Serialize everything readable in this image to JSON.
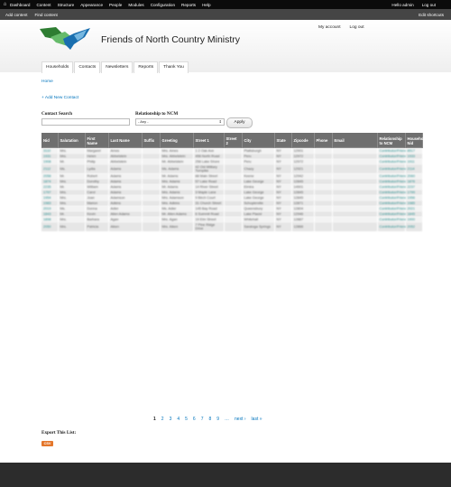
{
  "admin_menu": {
    "home_icon": "home-icon",
    "items": [
      "Dashboard",
      "Content",
      "Structure",
      "Appearance",
      "People",
      "Modules",
      "Configuration",
      "Reports",
      "Help"
    ],
    "hello": "Hello admin",
    "logout": "Log out"
  },
  "shortcuts": {
    "links": [
      "Add content",
      "Find content"
    ],
    "edit": "Edit shortcuts"
  },
  "header": {
    "site_name": "Friends of North Country Ministry",
    "my_account": "My account",
    "logout": "Log out",
    "logo_colors": [
      "#2e7d32",
      "#66bb6a",
      "#1a6faf",
      "#76b7e0"
    ]
  },
  "tabs": [
    "Households",
    "Contacts",
    "Newsletters",
    "Reports",
    "Thank You"
  ],
  "breadcrumb": "Home",
  "add_new": "+ Add New Contact",
  "filters": {
    "search_label": "Contact Search",
    "relationship_label": "Relationship to NCM",
    "relationship_value": "- Any -",
    "apply": "Apply"
  },
  "table": {
    "headers": [
      "Nid",
      "Salutation",
      "First Name",
      "Last Name",
      "Suffix",
      "Greeting",
      "Street 1",
      "Street 2",
      "City",
      "State",
      "Zipcode",
      "Phone",
      "Email",
      "Relationship to NCM",
      "Household Nid"
    ],
    "rows": [
      [
        "3110",
        "Mrs.",
        "Margaret",
        "Ames",
        "",
        "Mrs. Ames",
        "1 2 Oak Ave",
        "",
        "Plattsburgh",
        "NY",
        "12901",
        "",
        "",
        "Contributor/Friend",
        "8517"
      ],
      [
        "1931",
        "Mrs.",
        "Helen",
        "Abbelstein",
        "",
        "Mrs. Abbelstein",
        "456 North Road",
        "",
        "Peru",
        "NY",
        "12972",
        "",
        "",
        "Contributor/Friend",
        "1933"
      ],
      [
        "1908",
        "Mr.",
        "Philip",
        "Abbelstein",
        "",
        "Mr. Abbelstein",
        "256 Lake Shore",
        "",
        "Peru",
        "NY",
        "12972",
        "",
        "",
        "Contributor/Friend",
        "1911"
      ],
      [
        "2112",
        "Ms.",
        "Lydia",
        "Adams",
        "",
        "Ms. Adams",
        "42 Old Military Turnpike",
        "",
        "Chazy",
        "NY",
        "12921",
        "",
        "",
        "Contributor/Friend",
        "2114"
      ],
      [
        "2058",
        "Mr.",
        "Robert",
        "Adams",
        "",
        "Mr. Adams",
        "88 Main Street",
        "",
        "Keene",
        "NY",
        "12942",
        "",
        "",
        "Contributor/Friend",
        "2060"
      ],
      [
        "1874",
        "Mrs.",
        "Dorothy",
        "Adams",
        "",
        "Mrs. Adams",
        "57 Lake Road",
        "",
        "Lake George",
        "NY",
        "12845",
        "",
        "",
        "Contributor/Friend",
        "1876"
      ],
      [
        "2235",
        "Mr.",
        "William",
        "Adams",
        "",
        "Mr. Adams",
        "14 River Street",
        "",
        "Elmira",
        "NY",
        "14901",
        "",
        "",
        "Contributor/Friend",
        "2237"
      ],
      [
        "1797",
        "Mrs.",
        "Carol",
        "Adams",
        "",
        "Mrs. Adams",
        "3 Maple Lane",
        "",
        "Lake George",
        "NY",
        "12845",
        "",
        "",
        "Contributor/Friend",
        "1799"
      ],
      [
        "1954",
        "Mrs.",
        "Joan",
        "Adamson",
        "",
        "Mrs. Adamson",
        "9 Birch Court",
        "",
        "Lake George",
        "NY",
        "12845",
        "",
        "",
        "Contributor/Friend",
        "1956"
      ],
      [
        "1983",
        "Mrs.",
        "Marion",
        "Adkins",
        "",
        "Mrs. Adkins",
        "31 Church Street",
        "",
        "Schuylerville",
        "NY",
        "12871",
        "",
        "",
        "Contributor/Friend",
        "1985"
      ],
      [
        "2019",
        "Ms.",
        "Donna",
        "Adler",
        "",
        "Ms. Adler",
        "145 Bay Road",
        "",
        "Queensbury",
        "NY",
        "12804",
        "",
        "",
        "Contributor/Friend",
        "2021"
      ],
      [
        "1843",
        "Mr.",
        "Kevin",
        "Allen Adams",
        "",
        "Mr. Allen Adams",
        "6 Summit Road",
        "",
        "Lake Placid",
        "NY",
        "12946",
        "",
        "",
        "Contributor/Friend",
        "1845"
      ],
      [
        "1898",
        "Mrs.",
        "Barbara",
        "Agan",
        "",
        "Mrs. Agan",
        "19 Elm Street",
        "",
        "Whitehall",
        "NY",
        "12887",
        "",
        "",
        "Contributor/Friend",
        "1900"
      ],
      [
        "2050",
        "Mrs.",
        "Patricia",
        "Aiken",
        "",
        "Mrs. Aiken",
        "7 Pine Ridge Drive",
        "",
        "Saratoga Springs",
        "NY",
        "12866",
        "",
        "",
        "Contributor/Friend",
        "2052"
      ]
    ]
  },
  "pager": {
    "pages": [
      "1",
      "2",
      "3",
      "4",
      "5",
      "6",
      "7",
      "8",
      "9"
    ],
    "current": "1",
    "ellipsis": "…",
    "next": "next ›",
    "last": "last »"
  },
  "export": {
    "label": "Export This List:",
    "csv": "CSV"
  }
}
